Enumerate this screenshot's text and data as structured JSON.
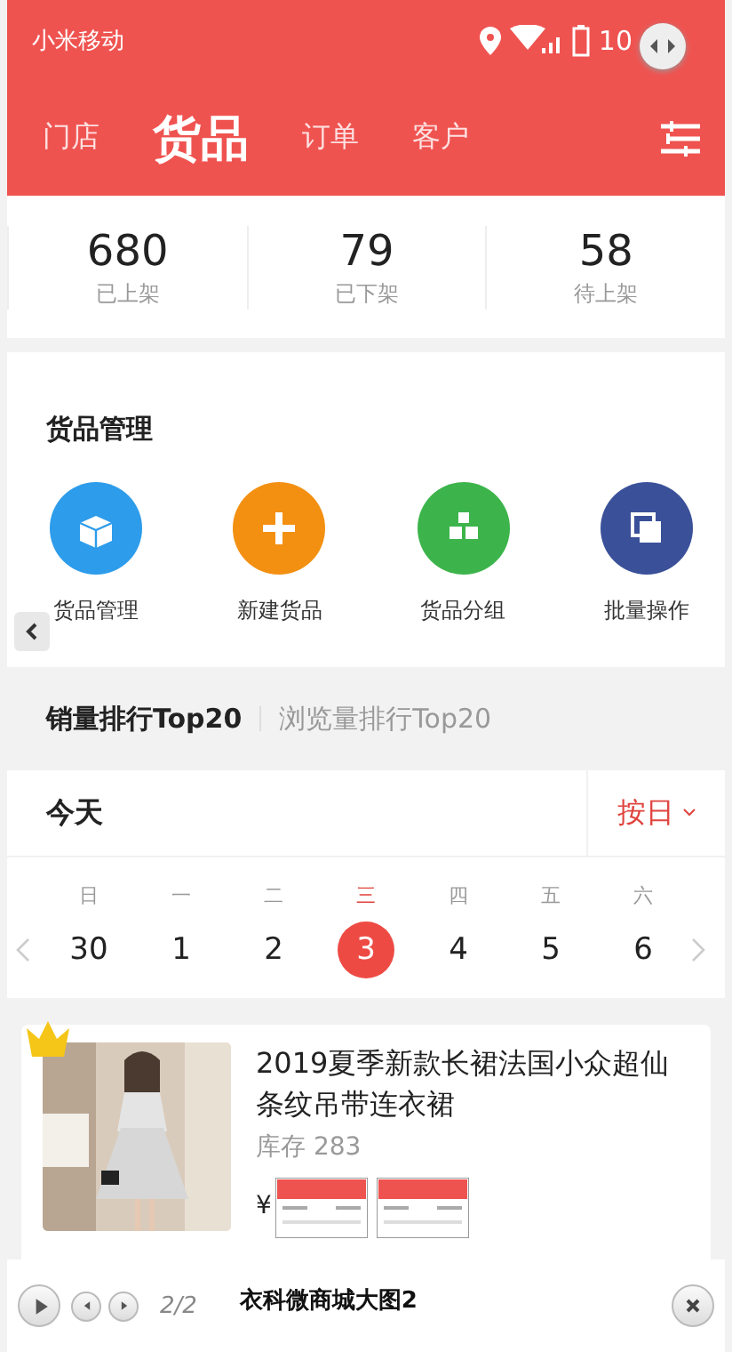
{
  "status_bar": {
    "carrier": "小米移动",
    "time": "10"
  },
  "nav_tabs": [
    {
      "label": "门店",
      "selected": false
    },
    {
      "label": "货品",
      "selected": true
    },
    {
      "label": "订单",
      "selected": false
    },
    {
      "label": "客户",
      "selected": false
    }
  ],
  "stats": [
    {
      "value": "680",
      "label": "已上架"
    },
    {
      "value": "79",
      "label": "已下架"
    },
    {
      "value": "58",
      "label": "待上架"
    }
  ],
  "goods_management": {
    "title": "货品管理",
    "actions": [
      {
        "label": "货品管理",
        "color": "#2d9cea",
        "kind": "cube"
      },
      {
        "label": "新建货品",
        "color": "#f39012",
        "kind": "plus"
      },
      {
        "label": "货品分组",
        "color": "#3cb44b",
        "kind": "cubes"
      },
      {
        "label": "批量操作",
        "color": "#3a5199",
        "kind": "layers"
      }
    ]
  },
  "ranking_tabs": [
    {
      "label": "销量排行Top20",
      "selected": true
    },
    {
      "label": "浏览量排行Top20",
      "selected": false
    }
  ],
  "date_picker": {
    "title": "今天",
    "mode": "按日",
    "days": [
      {
        "weekday": "日",
        "day": "30",
        "selected": false
      },
      {
        "weekday": "一",
        "day": "1",
        "selected": false
      },
      {
        "weekday": "二",
        "day": "2",
        "selected": false
      },
      {
        "weekday": "三",
        "day": "3",
        "selected": true
      },
      {
        "weekday": "四",
        "day": "4",
        "selected": false
      },
      {
        "weekday": "五",
        "day": "5",
        "selected": false
      },
      {
        "weekday": "六",
        "day": "6",
        "selected": false
      }
    ]
  },
  "product": {
    "title": "2019夏季新款长裙法国小众超仙条纹吊带连衣裙",
    "stock": "库存 283",
    "price": "¥"
  },
  "viewer": {
    "page": "2/2",
    "caption": "衣科微商城大图2"
  }
}
